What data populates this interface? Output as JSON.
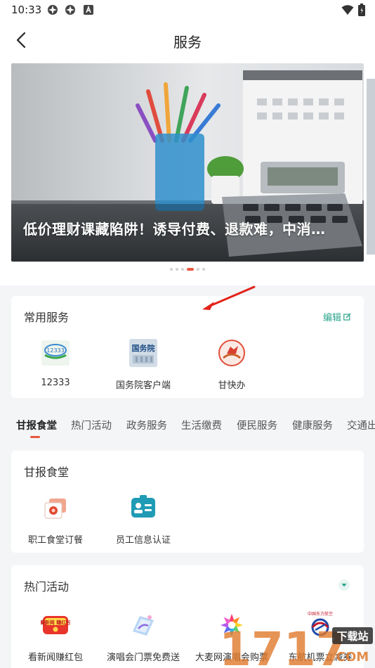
{
  "status_bar": {
    "time": "10:33"
  },
  "nav": {
    "title": "服务"
  },
  "banner": {
    "caption": "低价理财课藏陷阱！诱导付费、退款难，中消…",
    "slide_count": 6,
    "active_slide": 4
  },
  "common_services": {
    "title": "常用服务",
    "edit_label": "编辑",
    "items": [
      {
        "label": "12333",
        "icon": "12333-logo-icon"
      },
      {
        "label": "国务院客户端",
        "icon": "state-council-icon",
        "icon_text": "国务院"
      },
      {
        "label": "甘快办",
        "icon": "gankuaiban-logo-icon"
      }
    ]
  },
  "tabs": {
    "items": [
      "甘报食堂",
      "热门活动",
      "政务服务",
      "生活缴费",
      "便民服务",
      "健康服务",
      "交通出行"
    ],
    "active_index": 0
  },
  "canteen": {
    "title": "甘报食堂",
    "items": [
      {
        "label": "职工食堂订餐",
        "icon": "meal-order-icon"
      },
      {
        "label": "员工信息认证",
        "icon": "id-card-icon"
      }
    ]
  },
  "hot_activities": {
    "title": "热门活动",
    "items": [
      {
        "label": "看新闻赚红包",
        "icon": "news-red-packet-icon",
        "icon_text": "看新闻 赚红包"
      },
      {
        "label": "演唱会门票免费送",
        "icon": "concert-ticket-icon"
      },
      {
        "label": "大麦网演唱会购票",
        "icon": "damai-logo-icon"
      },
      {
        "label": "东航机票立减券",
        "icon": "china-eastern-logo-icon",
        "icon_text": "中国东方航空"
      }
    ]
  },
  "watermark": {
    "text": "1717",
    "sub": "下载站",
    "domain": "COM"
  },
  "colors": {
    "accent": "#e8593f",
    "teal": "#2aa48c",
    "background": "#f4f5f7"
  }
}
